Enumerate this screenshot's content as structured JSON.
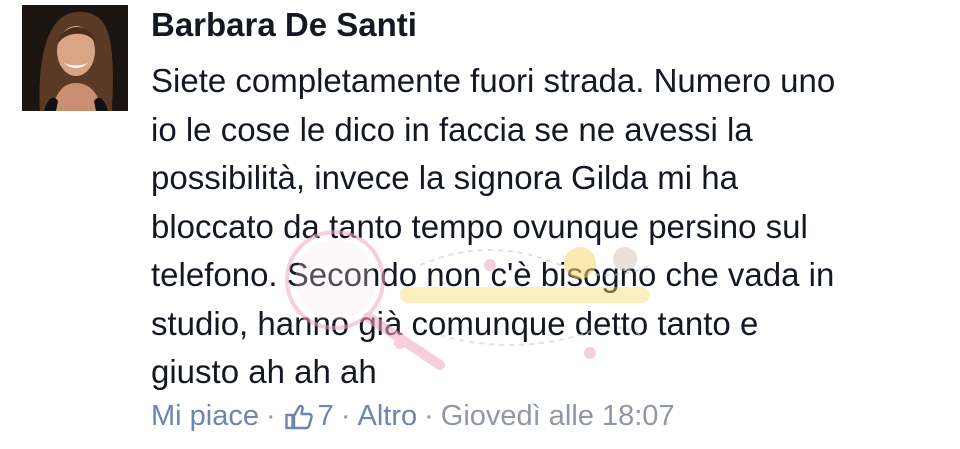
{
  "comment": {
    "author_name": "Barbara De Santi",
    "message_lines": [
      "Siete completamente fuori strada. Numero uno",
      "io le cose le dico in faccia se ne avessi la",
      "possibilità, invece la signora Gilda mi ha",
      "bloccato da tanto tempo ovunque persino sul",
      "telefono. Secondo non c'è bisogno che vada in",
      "studio, hanno già comunque detto tanto e",
      "giusto ah ah ah"
    ],
    "actions": {
      "like_label": "Mi piace",
      "like_icon": "thumbs-up-icon",
      "like_count": "7",
      "more_label": "Altro",
      "timestamp": "Giovedì alle 18:07",
      "separator": "·"
    }
  },
  "colors": {
    "text": "#141823",
    "link": "#6d84b4",
    "meta": "#9197a3",
    "watermark_pink": "#f2a7c3",
    "watermark_yellow": "#f5d76e"
  }
}
